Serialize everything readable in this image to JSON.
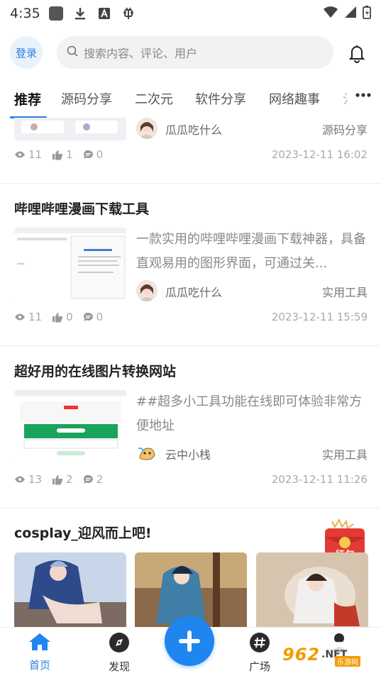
{
  "status_bar": {
    "time": "4:35"
  },
  "header": {
    "login_label": "登录",
    "search_placeholder": "搜索内容、评论、用户"
  },
  "tabs": [
    {
      "label": "推荐",
      "active": true
    },
    {
      "label": "源码分享"
    },
    {
      "label": "二次元"
    },
    {
      "label": "软件分享"
    },
    {
      "label": "网络趣事"
    },
    {
      "label": "氵"
    }
  ],
  "posts": [
    {
      "title": "",
      "author": "瓜瓜吃什么",
      "category": "源码分享",
      "views": "11",
      "likes": "1",
      "comments": "0",
      "date": "2023-12-11 16:02"
    },
    {
      "title": "哔哩哔哩漫画下载工具",
      "excerpt": "一款实用的哔哩哔哩漫画下载神器，具备直观易用的图形界面，可通过关...",
      "author": "瓜瓜吃什么",
      "category": "实用工具",
      "views": "11",
      "likes": "0",
      "comments": "0",
      "date": "2023-12-11 15:59"
    },
    {
      "title": "超好用的在线图片转换网站",
      "excerpt": "##超多小工具功能在线即可体验非常方便地址",
      "author": "云中小栈",
      "category": "实用工具",
      "views": "13",
      "likes": "2",
      "comments": "2",
      "date": "2023-12-11 11:26"
    }
  ],
  "section": {
    "title": "cosplay_迎风而上吧!",
    "badge_text": "红包大派送"
  },
  "bottom_nav": [
    {
      "label": "首页",
      "icon": "home-icon",
      "active": true
    },
    {
      "label": "发现",
      "icon": "compass-icon"
    },
    {
      "label": "",
      "icon": "plus-icon"
    },
    {
      "label": "广场",
      "icon": "hashtag-icon"
    },
    {
      "label": "",
      "icon": "user-icon"
    }
  ],
  "watermark": {
    "main": "962",
    "suffix": ".NET",
    "sub": "乐游网"
  },
  "colors": {
    "accent": "#1f86ef",
    "text": "#222222",
    "muted": "#aaaaaa"
  }
}
